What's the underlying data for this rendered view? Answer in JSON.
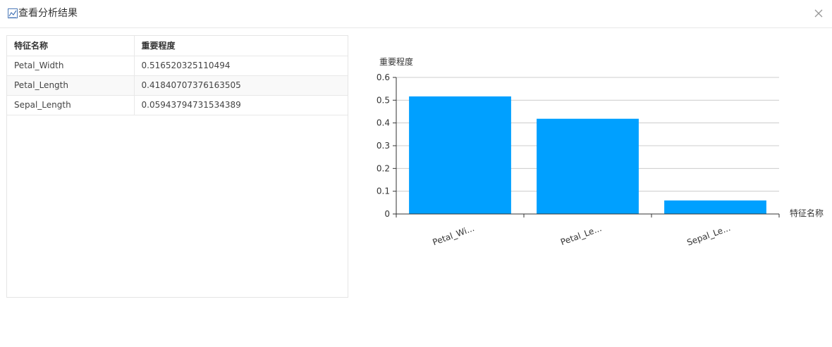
{
  "dialog": {
    "title": "查看分析结果",
    "title_icon": "chart-analysis-icon",
    "close_icon": "close-icon"
  },
  "table": {
    "headers": [
      "特征名称",
      "重要程度"
    ],
    "rows": [
      [
        "Petal_Width",
        "0.516520325110494"
      ],
      [
        "Petal_Length",
        "0.41840707376163505"
      ],
      [
        "Sepal_Length",
        "0.05943794731534389"
      ]
    ]
  },
  "chart_data": {
    "type": "bar",
    "categories": [
      "Petal_Width",
      "Petal_Length",
      "Sepal_Length"
    ],
    "category_labels": [
      "Petal_Wi...",
      "Petal_Le...",
      "Sepal_Le..."
    ],
    "values": [
      0.516520325110494,
      0.41840707376163505,
      0.05943794731534389
    ],
    "xlabel": "特征名称",
    "ylabel": "重要程度",
    "ylim": [
      0,
      0.6
    ],
    "yticks": [
      "0",
      "0.1",
      "0.2",
      "0.3",
      "0.4",
      "0.5",
      "0.6"
    ],
    "grid": true,
    "bar_color": "#00a0ff"
  }
}
